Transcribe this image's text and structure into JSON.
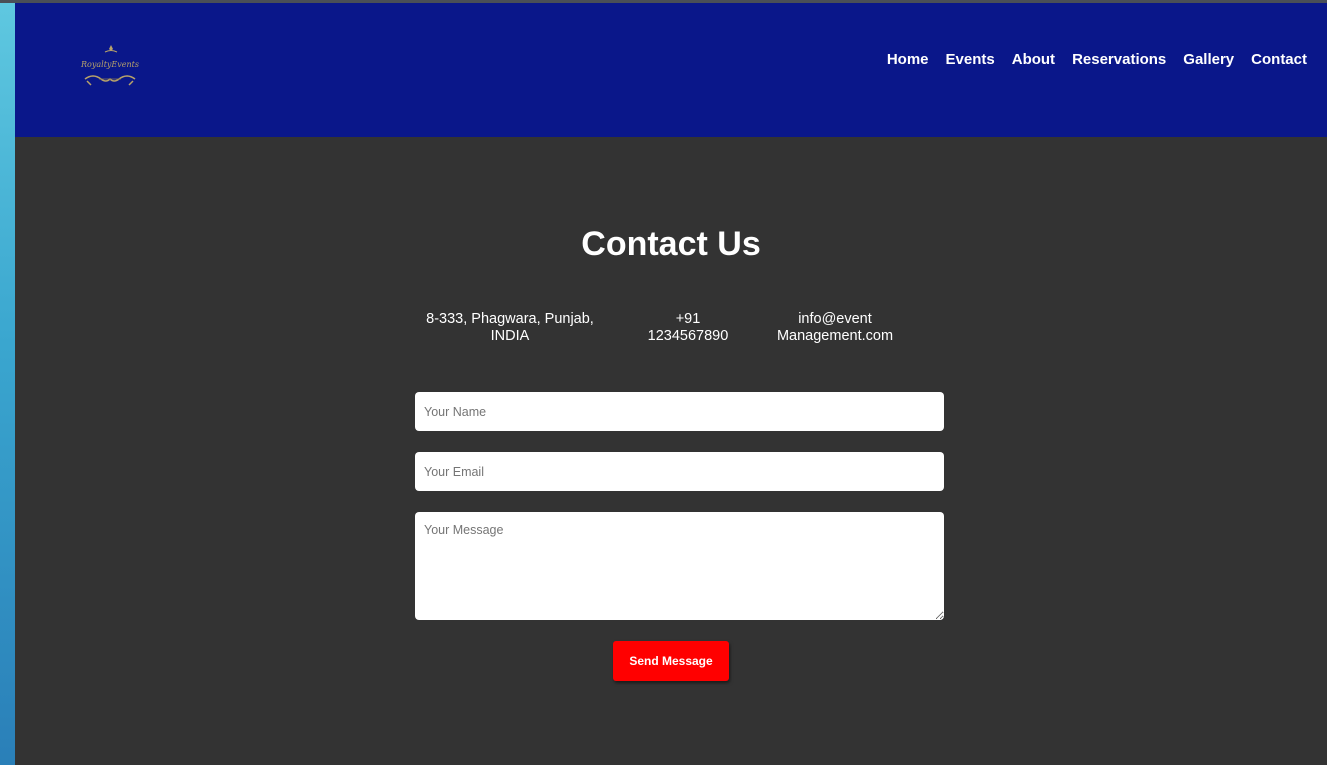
{
  "header": {
    "logo_text": "ROYALTY EVENTS",
    "nav": [
      {
        "label": "Home"
      },
      {
        "label": "Events"
      },
      {
        "label": "About"
      },
      {
        "label": "Reservations"
      },
      {
        "label": "Gallery"
      },
      {
        "label": "Contact"
      }
    ]
  },
  "contact": {
    "title": "Contact Us",
    "address": {
      "line1": "8-333, Phagwara, Punjab,",
      "line2": "INDIA"
    },
    "phone": {
      "line1": "+91",
      "line2": "1234567890"
    },
    "email": {
      "line1": "info@event",
      "line2": "Management.com"
    }
  },
  "form": {
    "name_placeholder": "Your Name",
    "email_placeholder": "Your Email",
    "message_placeholder": "Your Message",
    "submit_label": "Send Message"
  },
  "colors": {
    "header_bg": "#0a178a",
    "page_bg": "#333333",
    "button_bg": "#ff0000",
    "side_strip": "#3aa6cf"
  }
}
